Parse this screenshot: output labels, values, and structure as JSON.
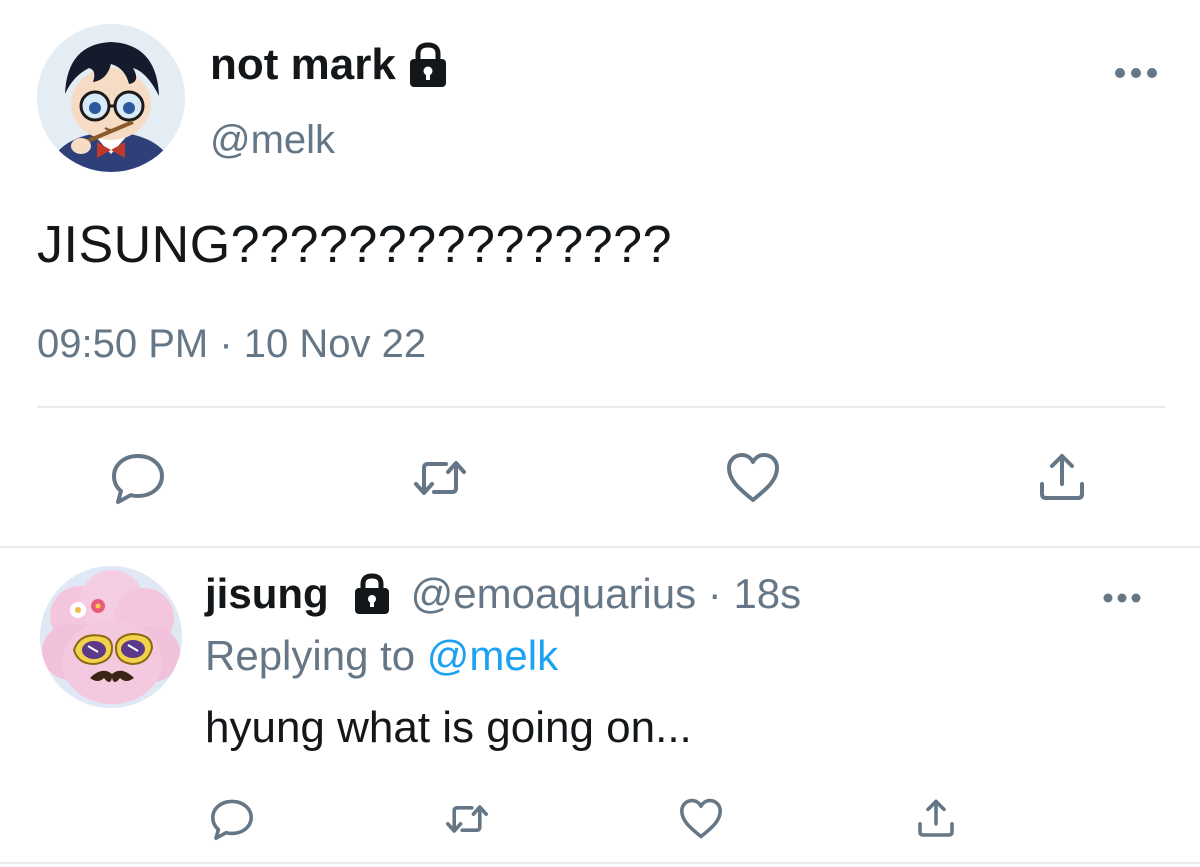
{
  "main_tweet": {
    "display_name": "not mark",
    "handle": "@melk",
    "text": "JISUNG???????????????",
    "timestamp": "09:50 PM · 10 Nov 22",
    "avatar_icon": "anime-boy-glasses-avatar",
    "actions": [
      "reply-icon",
      "retweet-icon",
      "like-icon",
      "share-icon"
    ]
  },
  "reply_tweet": {
    "display_name": "jisung",
    "meta": "@emoaquarius · 18s",
    "replying_prefix": "Replying to ",
    "replying_handle": "@melk",
    "text": "hyung what is going on...",
    "avatar_icon": "pink-sheep-sunglasses-avatar",
    "actions": [
      "reply-icon",
      "retweet-icon",
      "like-icon",
      "share-icon"
    ]
  },
  "colors": {
    "text": "#14171a",
    "secondary": "#657786",
    "accent": "#1da1f2",
    "divider": "#e6ecf0"
  }
}
